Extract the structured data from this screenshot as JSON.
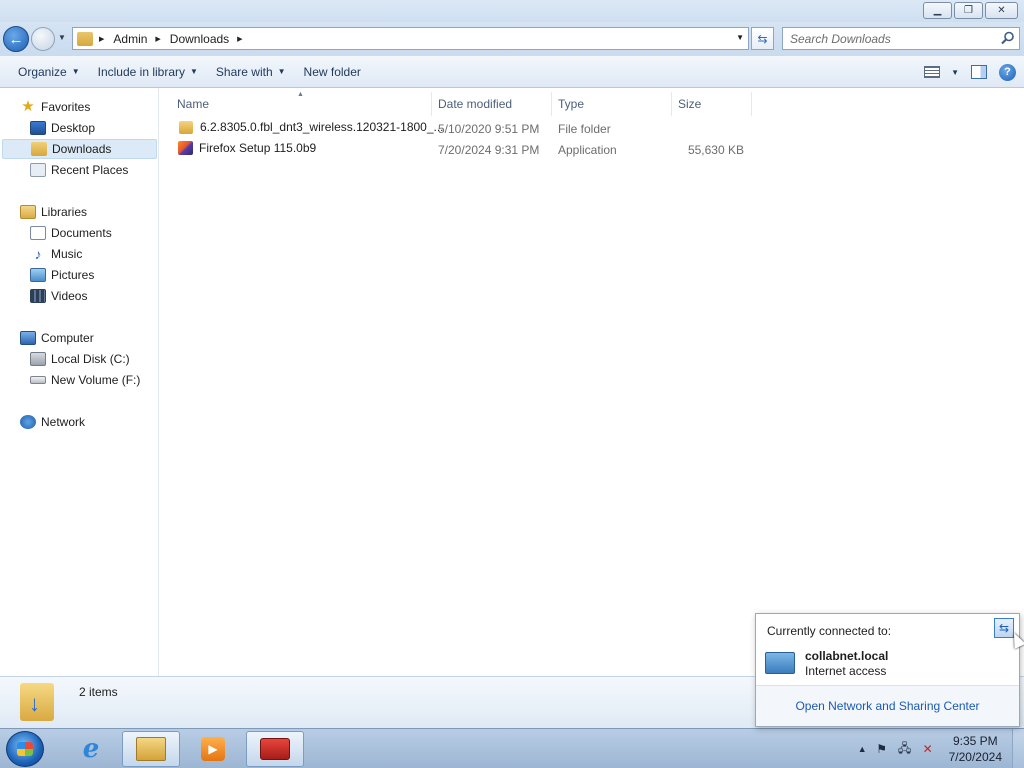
{
  "window": {
    "minimize_icon": "minimize-icon",
    "maximize_icon": "restore-icon",
    "close_icon": "close-icon"
  },
  "address_bar": {
    "breadcrumbs": [
      "Admin",
      "Downloads"
    ],
    "search_placeholder": "Search Downloads"
  },
  "toolbar": {
    "organize": "Organize",
    "include_in_library": "Include in library",
    "share_with": "Share with",
    "new_folder": "New folder"
  },
  "nav": {
    "favorites": {
      "label": "Favorites",
      "items": [
        "Desktop",
        "Downloads",
        "Recent Places"
      ]
    },
    "libraries": {
      "label": "Libraries",
      "items": [
        "Documents",
        "Music",
        "Pictures",
        "Videos"
      ]
    },
    "computer": {
      "label": "Computer",
      "items": [
        "Local Disk (C:)",
        "New Volume (F:)"
      ]
    },
    "network": {
      "label": "Network"
    },
    "selected": "Downloads"
  },
  "file_list": {
    "columns": [
      "Name",
      "Date modified",
      "Type",
      "Size"
    ],
    "rows": [
      {
        "name": "6.2.8305.0.fbl_dnt3_wireless.120321-1800_...",
        "date": "5/10/2020 9:51 PM",
        "type": "File folder",
        "size": ""
      },
      {
        "name": "Firefox Setup 115.0b9",
        "date": "7/20/2024 9:31 PM",
        "type": "Application",
        "size": "55,630 KB"
      }
    ]
  },
  "details": {
    "count": "2 items"
  },
  "network_popup": {
    "header": "Currently connected to:",
    "network_name": "collabnet.local",
    "status": "Internet access",
    "link": "Open Network and Sharing Center"
  },
  "taskbar": {
    "time": "9:35 PM",
    "date": "7/20/2024"
  }
}
